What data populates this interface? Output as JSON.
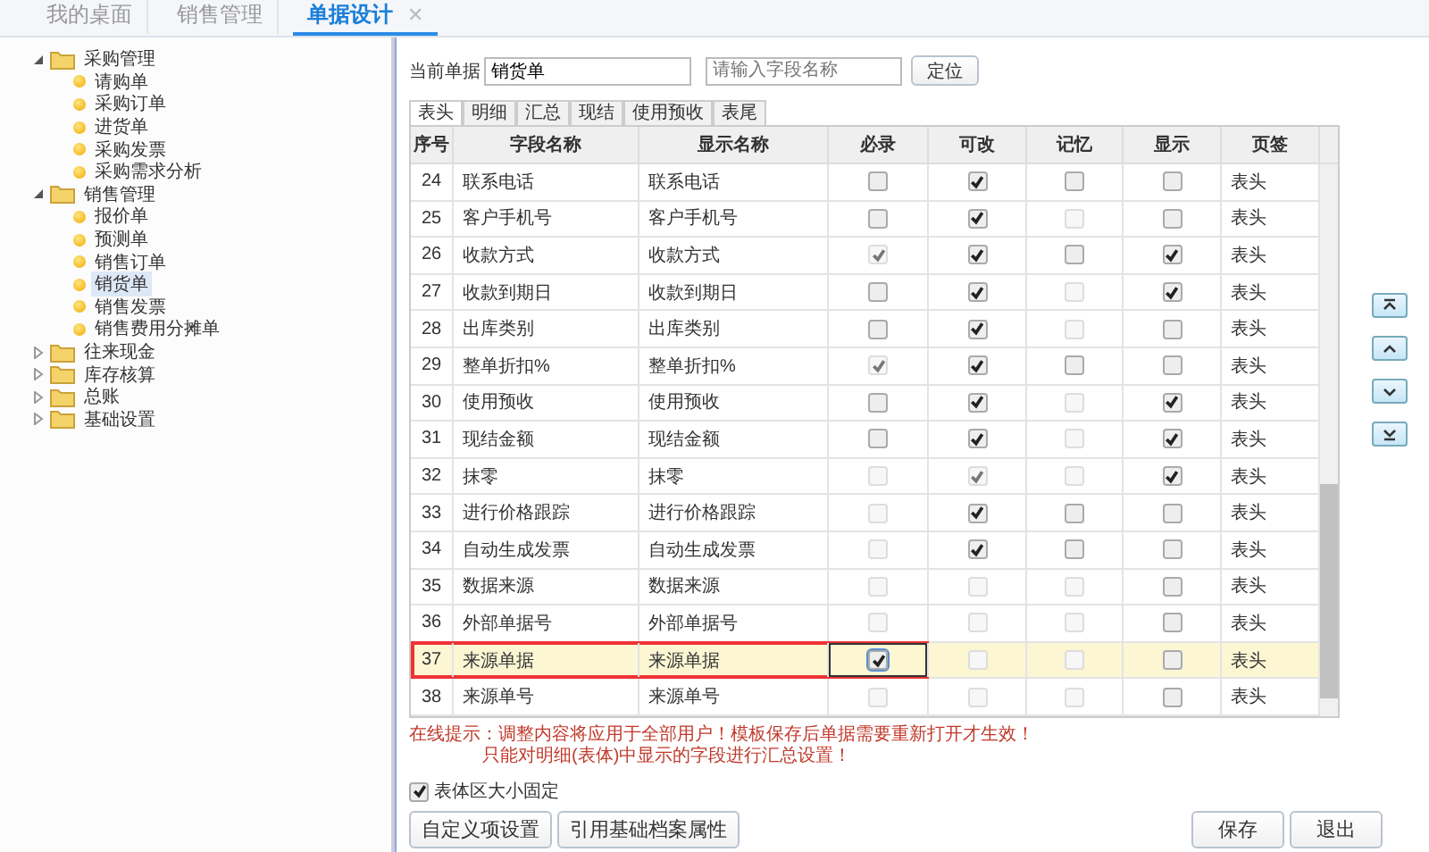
{
  "top_tabs": [
    {
      "label": "我的桌面",
      "selected": false
    },
    {
      "label": "销售管理",
      "selected": false
    },
    {
      "label": "单据设计",
      "selected": true,
      "close_label": "✕"
    }
  ],
  "tree": [
    {
      "label": "采购管理",
      "expanded": true,
      "children": [
        {
          "label": "请购单",
          "selected": false
        },
        {
          "label": "采购订单",
          "selected": false
        },
        {
          "label": "进货单",
          "selected": false
        },
        {
          "label": "采购发票",
          "selected": false
        },
        {
          "label": "采购需求分析",
          "selected": false
        }
      ]
    },
    {
      "label": "销售管理",
      "expanded": true,
      "children": [
        {
          "label": "报价单",
          "selected": false
        },
        {
          "label": "预测单",
          "selected": false
        },
        {
          "label": "销售订单",
          "selected": false
        },
        {
          "label": "销货单",
          "selected": true
        },
        {
          "label": "销售发票",
          "selected": false
        },
        {
          "label": "销售费用分摊单",
          "selected": false
        }
      ]
    },
    {
      "label": "往来现金",
      "expanded": false
    },
    {
      "label": "库存核算",
      "expanded": false
    },
    {
      "label": "总账",
      "expanded": false
    },
    {
      "label": "基础设置",
      "expanded": false
    }
  ],
  "current_doc": {
    "label": "当前单据",
    "value": "销货单"
  },
  "search": {
    "placeholder": "请输入字段名称"
  },
  "locate_button": "定位",
  "section_tabs": [
    {
      "label": "表头",
      "selected": true
    },
    {
      "label": "明细",
      "selected": false
    },
    {
      "label": "汇总",
      "selected": false
    },
    {
      "label": "现结",
      "selected": false
    },
    {
      "label": "使用预收",
      "selected": false
    },
    {
      "label": "表尾",
      "selected": false
    }
  ],
  "table": {
    "columns": [
      "序号",
      "字段名称",
      "显示名称",
      "必录",
      "可改",
      "记忆",
      "显示",
      "页签"
    ],
    "rows": [
      {
        "no": "24",
        "field": "联系电话",
        "display_name": "联系电话",
        "selected": false,
        "flags": [
          {
            "checked": false,
            "disabled": false
          },
          {
            "checked": true,
            "disabled": false
          },
          {
            "checked": false,
            "disabled": false
          },
          {
            "checked": false,
            "disabled": false
          }
        ],
        "tab": "表头"
      },
      {
        "no": "25",
        "field": "客户手机号",
        "display_name": "客户手机号",
        "selected": false,
        "flags": [
          {
            "checked": false,
            "disabled": false
          },
          {
            "checked": true,
            "disabled": false
          },
          {
            "checked": false,
            "disabled": true
          },
          {
            "checked": false,
            "disabled": false
          }
        ],
        "tab": "表头"
      },
      {
        "no": "26",
        "field": "收款方式",
        "display_name": "收款方式",
        "selected": false,
        "flags": [
          {
            "checked": true,
            "disabled": true
          },
          {
            "checked": true,
            "disabled": false
          },
          {
            "checked": false,
            "disabled": false
          },
          {
            "checked": true,
            "disabled": false
          }
        ],
        "tab": "表头"
      },
      {
        "no": "27",
        "field": "收款到期日",
        "display_name": "收款到期日",
        "selected": false,
        "flags": [
          {
            "checked": false,
            "disabled": false
          },
          {
            "checked": true,
            "disabled": false
          },
          {
            "checked": false,
            "disabled": true
          },
          {
            "checked": true,
            "disabled": false
          }
        ],
        "tab": "表头"
      },
      {
        "no": "28",
        "field": "出库类别",
        "display_name": "出库类别",
        "selected": false,
        "flags": [
          {
            "checked": false,
            "disabled": false
          },
          {
            "checked": true,
            "disabled": false
          },
          {
            "checked": false,
            "disabled": true
          },
          {
            "checked": false,
            "disabled": false
          }
        ],
        "tab": "表头"
      },
      {
        "no": "29",
        "field": "整单折扣%",
        "display_name": "整单折扣%",
        "selected": false,
        "flags": [
          {
            "checked": true,
            "disabled": true
          },
          {
            "checked": true,
            "disabled": false
          },
          {
            "checked": false,
            "disabled": false
          },
          {
            "checked": false,
            "disabled": false
          }
        ],
        "tab": "表头"
      },
      {
        "no": "30",
        "field": "使用预收",
        "display_name": "使用预收",
        "selected": false,
        "flags": [
          {
            "checked": false,
            "disabled": false
          },
          {
            "checked": true,
            "disabled": false
          },
          {
            "checked": false,
            "disabled": true
          },
          {
            "checked": true,
            "disabled": false
          }
        ],
        "tab": "表头"
      },
      {
        "no": "31",
        "field": "现结金额",
        "display_name": "现结金额",
        "selected": false,
        "flags": [
          {
            "checked": false,
            "disabled": false
          },
          {
            "checked": true,
            "disabled": false
          },
          {
            "checked": false,
            "disabled": true
          },
          {
            "checked": true,
            "disabled": false
          }
        ],
        "tab": "表头"
      },
      {
        "no": "32",
        "field": "抹零",
        "display_name": "抹零",
        "selected": false,
        "flags": [
          {
            "checked": false,
            "disabled": true
          },
          {
            "checked": true,
            "disabled": true
          },
          {
            "checked": false,
            "disabled": true
          },
          {
            "checked": true,
            "disabled": false
          }
        ],
        "tab": "表头"
      },
      {
        "no": "33",
        "field": "进行价格跟踪",
        "display_name": "进行价格跟踪",
        "selected": false,
        "flags": [
          {
            "checked": false,
            "disabled": true
          },
          {
            "checked": true,
            "disabled": false
          },
          {
            "checked": false,
            "disabled": false
          },
          {
            "checked": false,
            "disabled": false
          }
        ],
        "tab": "表头"
      },
      {
        "no": "34",
        "field": "自动生成发票",
        "display_name": "自动生成发票",
        "selected": false,
        "flags": [
          {
            "checked": false,
            "disabled": true
          },
          {
            "checked": true,
            "disabled": false
          },
          {
            "checked": false,
            "disabled": false
          },
          {
            "checked": false,
            "disabled": false
          }
        ],
        "tab": "表头"
      },
      {
        "no": "35",
        "field": "数据来源",
        "display_name": "数据来源",
        "selected": false,
        "flags": [
          {
            "checked": false,
            "disabled": true
          },
          {
            "checked": false,
            "disabled": true
          },
          {
            "checked": false,
            "disabled": true
          },
          {
            "checked": false,
            "disabled": false
          }
        ],
        "tab": "表头"
      },
      {
        "no": "36",
        "field": "外部单据号",
        "display_name": "外部单据号",
        "selected": false,
        "flags": [
          {
            "checked": false,
            "disabled": true
          },
          {
            "checked": false,
            "disabled": true
          },
          {
            "checked": false,
            "disabled": true
          },
          {
            "checked": false,
            "disabled": false
          }
        ],
        "tab": "表头"
      },
      {
        "no": "37",
        "field": "来源单据",
        "display_name": "来源单据",
        "selected": true,
        "flags": [
          {
            "checked": true,
            "disabled": false
          },
          {
            "checked": false,
            "disabled": true
          },
          {
            "checked": false,
            "disabled": true
          },
          {
            "checked": false,
            "disabled": false
          }
        ],
        "tab": "表头"
      },
      {
        "no": "38",
        "field": "来源单号",
        "display_name": "来源单号",
        "selected": false,
        "flags": [
          {
            "checked": false,
            "disabled": true
          },
          {
            "checked": false,
            "disabled": true
          },
          {
            "checked": false,
            "disabled": true
          },
          {
            "checked": false,
            "disabled": false
          }
        ],
        "tab": "表头"
      }
    ]
  },
  "hints": [
    "在线提示：调整内容将应用于全部用户！模板保存后单据需要重新打开才生效！",
    "只能对明细(表体)中显示的字段进行汇总设置！"
  ],
  "fixed_size": {
    "label": "表体区大小固定",
    "checked": true
  },
  "left_buttons": [
    "自定义项设置",
    "引用基础档案属性"
  ],
  "right_buttons": [
    "保存",
    "退出"
  ]
}
